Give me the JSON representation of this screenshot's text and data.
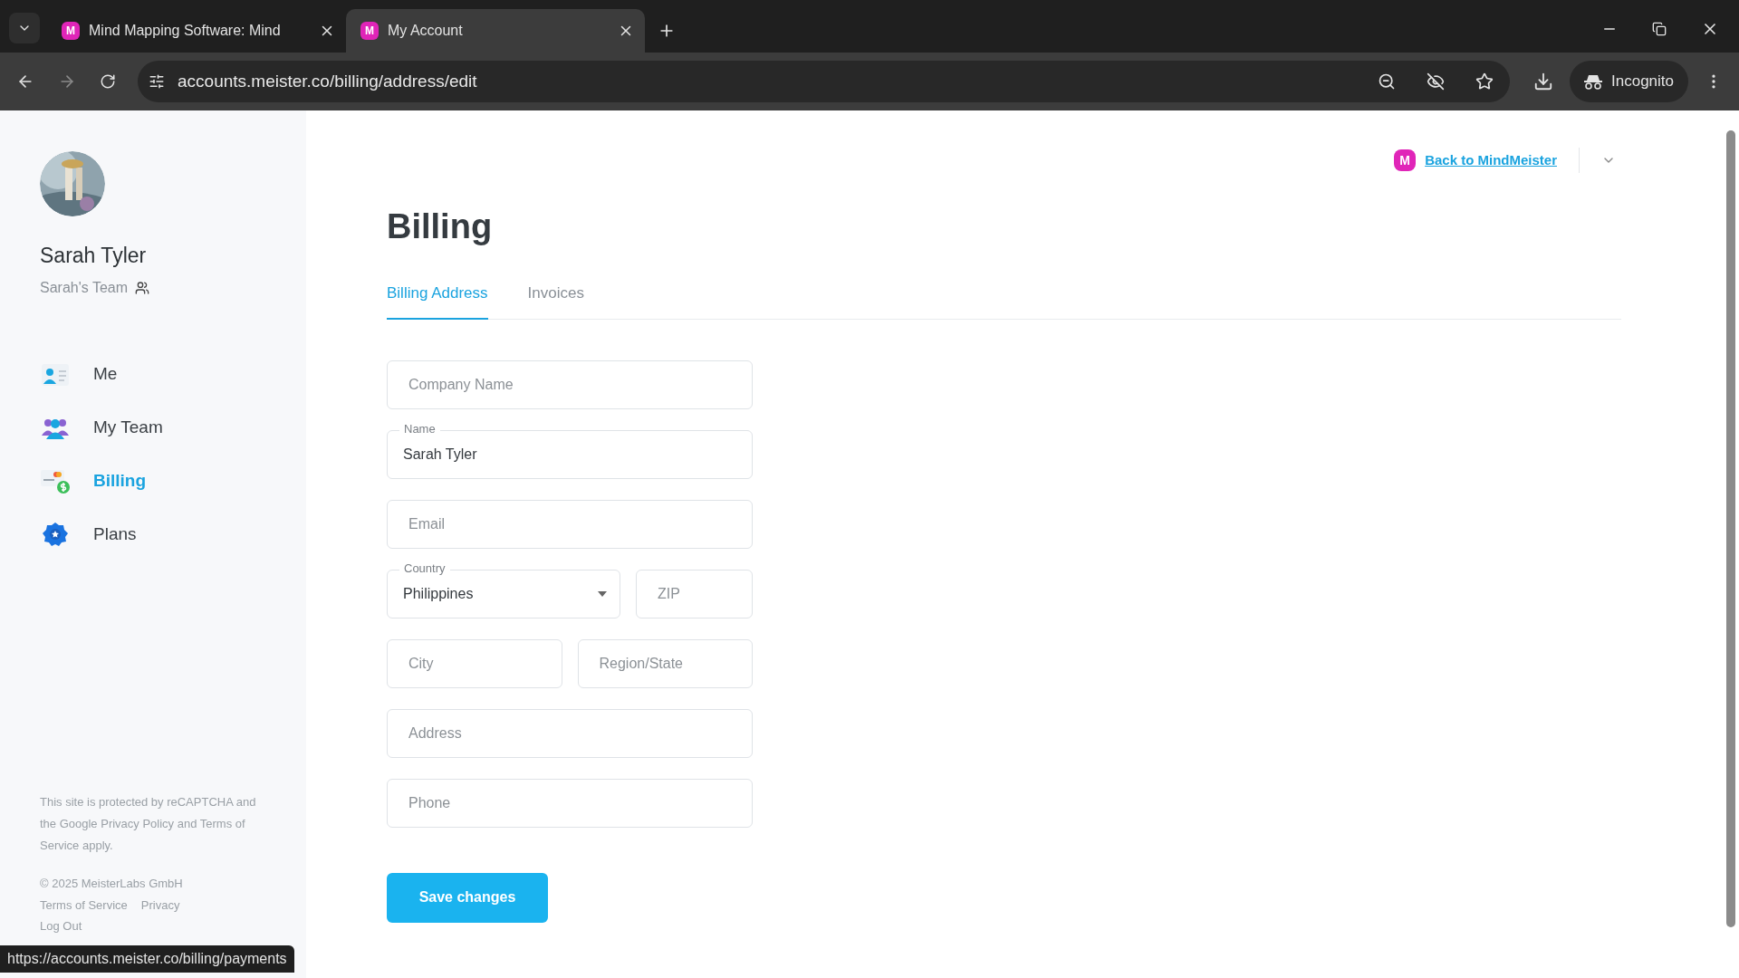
{
  "browser": {
    "tabs": [
      {
        "title": "Mind Mapping Software: Mind",
        "icon_letter": "M",
        "selected": false
      },
      {
        "title": "My Account",
        "icon_letter": "M",
        "selected": true
      }
    ],
    "url": "accounts.meister.co/billing/address/edit",
    "profile": "Incognito"
  },
  "sidebar": {
    "user_name": "Sarah Tyler",
    "team": "Sarah's Team",
    "items": [
      {
        "kind": "me",
        "label": "Me",
        "selected": false
      },
      {
        "kind": "team",
        "label": "My Team",
        "selected": false
      },
      {
        "kind": "billing",
        "label": "Billing",
        "selected": true
      },
      {
        "kind": "plans",
        "label": "Plans",
        "selected": false
      }
    ],
    "recaptcha_note": "This site is protected by reCAPTCHA and the Google Privacy Policy and Terms of Service apply.",
    "copyright": "© 2025 MeisterLabs GmbH",
    "links": [
      "Terms of Service",
      "Privacy"
    ],
    "logout": "Log Out"
  },
  "header": {
    "back_link": "Back to MindMeister",
    "logo_letter": "M"
  },
  "page": {
    "title": "Billing",
    "tabs": [
      {
        "label": "Billing Address",
        "selected": true
      },
      {
        "label": "Invoices",
        "selected": false
      }
    ]
  },
  "form": {
    "rows": [
      [
        {
          "kind": "text",
          "placeholder": "Company Name"
        }
      ],
      [
        {
          "kind": "text",
          "label": "Name",
          "value": "Sarah Tyler"
        }
      ],
      [
        {
          "kind": "text",
          "placeholder": "Email"
        }
      ],
      [
        {
          "kind": "select",
          "label": "Country",
          "value": "Philippines"
        },
        {
          "kind": "text",
          "placeholder": "ZIP"
        }
      ],
      [
        {
          "kind": "text",
          "placeholder": "City"
        },
        {
          "kind": "text",
          "placeholder": "Region/State"
        }
      ],
      [
        {
          "kind": "text",
          "placeholder": "Address"
        }
      ],
      [
        {
          "kind": "text",
          "placeholder": "Phone"
        }
      ]
    ],
    "save_button": "Save changes"
  },
  "status_url": "https://accounts.meister.co/billing/payments"
}
